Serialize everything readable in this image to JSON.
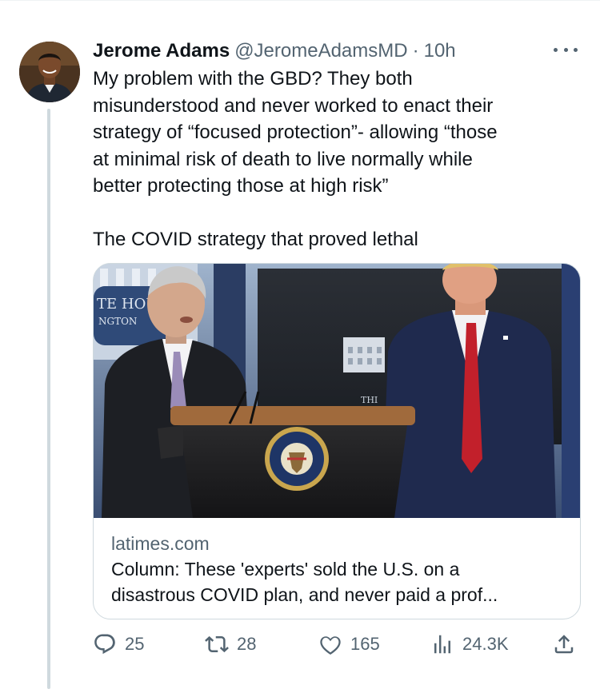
{
  "tweet": {
    "author_name": "Jerome Adams",
    "handle": "@JeromeAdamsMD",
    "separator": "·",
    "time": "10h",
    "text_lines": [
      "My problem with the GBD?  They both",
      "misunderstood and never worked to enact their",
      "strategy of “focused protection”- allowing “those",
      "at minimal risk of death to live normally while",
      "better protecting those at high risk”"
    ],
    "text_p2": "The COVID strategy that proved lethal"
  },
  "card": {
    "domain": "latimes.com",
    "title_line1": "Column: These 'experts' sold the U.S. on a",
    "title_line2": "disastrous COVID plan, and never paid a prof...",
    "image_signage": [
      "TE HOU",
      "NGTON",
      "THI"
    ]
  },
  "actions": {
    "replies": "25",
    "reposts": "28",
    "likes": "165",
    "views": "24.3K"
  },
  "colors": {
    "text": "#0f1419",
    "secondary": "#536471",
    "border": "#cfd9de"
  },
  "icons": [
    "more-icon",
    "reply-icon",
    "repost-icon",
    "like-icon",
    "views-icon",
    "share-icon"
  ]
}
